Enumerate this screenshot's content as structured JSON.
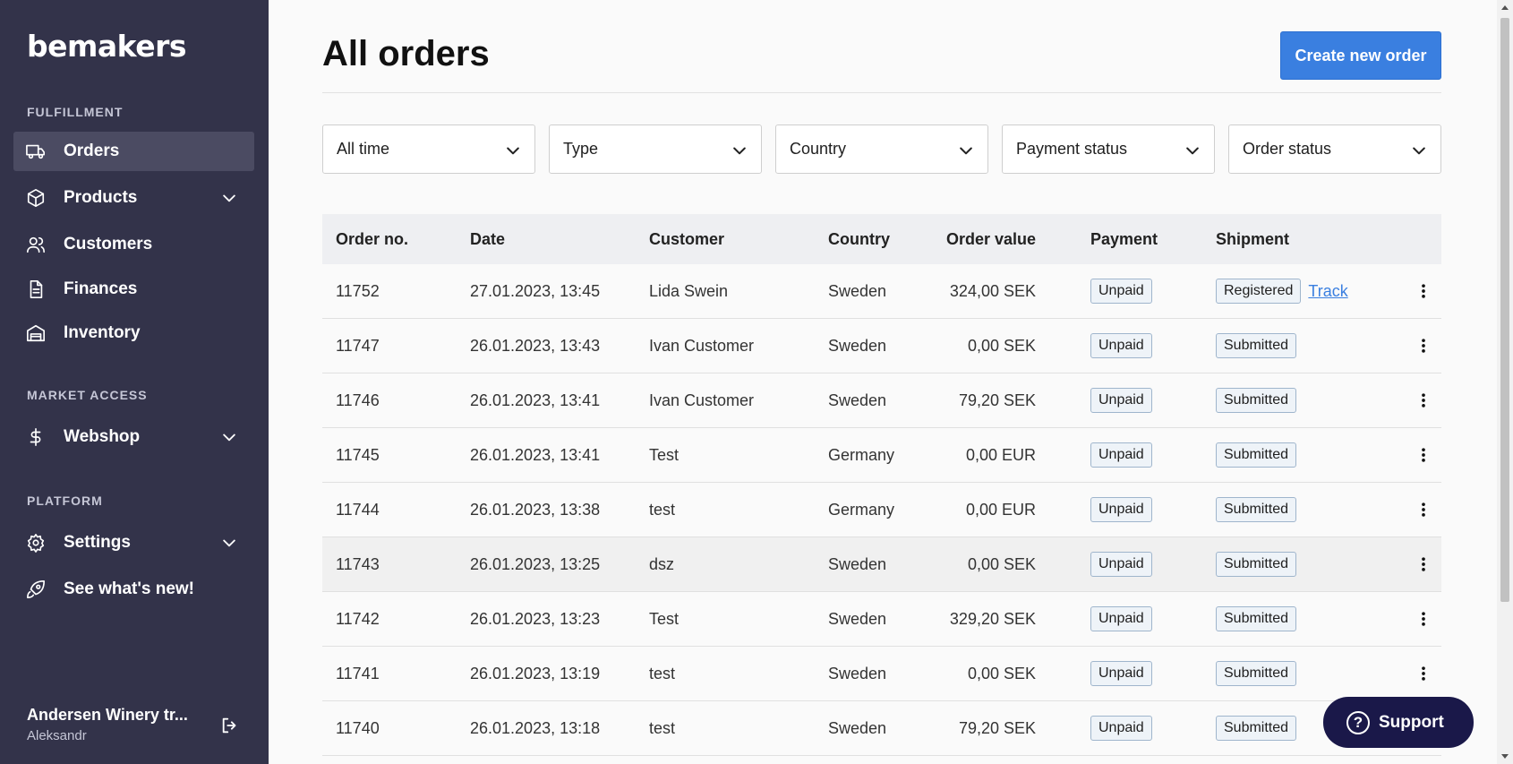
{
  "sidebar": {
    "logo": "bemakers",
    "sections": {
      "fulfillment": "FULFILLMENT",
      "market_access": "MARKET ACCESS",
      "platform": "PLATFORM"
    },
    "items": {
      "orders": "Orders",
      "products": "Products",
      "customers": "Customers",
      "finances": "Finances",
      "inventory": "Inventory",
      "webshop": "Webshop",
      "settings": "Settings",
      "whats_new": "See what's new!"
    },
    "user": {
      "name": "Andersen Winery tr...",
      "sub": "Aleksandr"
    }
  },
  "header": {
    "title": "All orders",
    "create_button": "Create new order"
  },
  "filters": {
    "time": "All time",
    "type": "Type",
    "country": "Country",
    "payment": "Payment status",
    "order_status": "Order status"
  },
  "table": {
    "headers": {
      "order_no": "Order no.",
      "date": "Date",
      "customer": "Customer",
      "country": "Country",
      "value": "Order value",
      "payment": "Payment",
      "shipment": "Shipment"
    },
    "rows": [
      {
        "no": "11752",
        "date": "27.01.2023, 13:45",
        "customer": "Lida Swein",
        "country": "Sweden",
        "value": "324,00 SEK",
        "payment": "Unpaid",
        "shipment": "Registered",
        "track": "Track"
      },
      {
        "no": "11747",
        "date": "26.01.2023, 13:43",
        "customer": "Ivan Customer",
        "country": "Sweden",
        "value": "0,00 SEK",
        "payment": "Unpaid",
        "shipment": "Submitted"
      },
      {
        "no": "11746",
        "date": "26.01.2023, 13:41",
        "customer": "Ivan Customer",
        "country": "Sweden",
        "value": "79,20 SEK",
        "payment": "Unpaid",
        "shipment": "Submitted"
      },
      {
        "no": "11745",
        "date": "26.01.2023, 13:41",
        "customer": "Test",
        "country": "Germany",
        "value": "0,00 EUR",
        "payment": "Unpaid",
        "shipment": "Submitted"
      },
      {
        "no": "11744",
        "date": "26.01.2023, 13:38",
        "customer": "test",
        "country": "Germany",
        "value": "0,00 EUR",
        "payment": "Unpaid",
        "shipment": "Submitted"
      },
      {
        "no": "11743",
        "date": "26.01.2023, 13:25",
        "customer": "dsz",
        "country": "Sweden",
        "value": "0,00 SEK",
        "payment": "Unpaid",
        "shipment": "Submitted"
      },
      {
        "no": "11742",
        "date": "26.01.2023, 13:23",
        "customer": "Test",
        "country": "Sweden",
        "value": "329,20 SEK",
        "payment": "Unpaid",
        "shipment": "Submitted"
      },
      {
        "no": "11741",
        "date": "26.01.2023, 13:19",
        "customer": "test",
        "country": "Sweden",
        "value": "0,00 SEK",
        "payment": "Unpaid",
        "shipment": "Submitted"
      },
      {
        "no": "11740",
        "date": "26.01.2023, 13:18",
        "customer": "test",
        "country": "Sweden",
        "value": "79,20 SEK",
        "payment": "Unpaid",
        "shipment": "Submitted"
      }
    ]
  },
  "support": {
    "label": "Support",
    "icon_glyph": "?"
  },
  "colors": {
    "sidebar_bg": "#33334a",
    "accent": "#3a7fe0",
    "support_bg": "#1a1849"
  }
}
